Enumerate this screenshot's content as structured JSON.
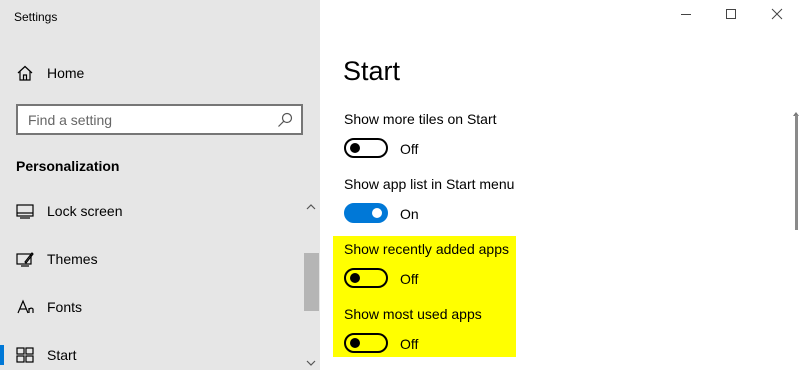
{
  "app": {
    "title": "Settings"
  },
  "sidebar": {
    "home_label": "Home",
    "search_placeholder": "Find a setting",
    "section_heading": "Personalization",
    "items": [
      {
        "label": "Lock screen",
        "icon": "lock-screen-icon"
      },
      {
        "label": "Themes",
        "icon": "themes-icon"
      },
      {
        "label": "Fonts",
        "icon": "fonts-icon"
      },
      {
        "label": "Start",
        "icon": "start-icon",
        "active": true
      }
    ]
  },
  "main": {
    "title": "Start",
    "settings": [
      {
        "label": "Show more tiles on Start",
        "state": "Off"
      },
      {
        "label": "Show app list in Start menu",
        "state": "On"
      },
      {
        "label": "Show recently added apps",
        "state": "Off"
      },
      {
        "label": "Show most used apps",
        "state": "Off"
      }
    ]
  },
  "colors": {
    "accent": "#0078d7",
    "highlight": "#ffff00",
    "sidebar_bg": "#e6e6e6"
  }
}
